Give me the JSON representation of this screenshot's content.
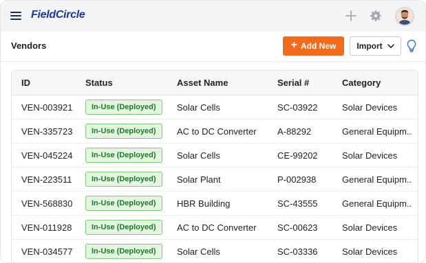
{
  "app": {
    "logo_text": "FieldCircle",
    "brand_color": "#1a3a8f"
  },
  "icons": {
    "menu": "hamburger-menu-icon",
    "add": "plus-icon",
    "settings": "gear-icon",
    "user": "avatar",
    "tips": "lightbulb-icon",
    "dropdown": "chevron-down-icon"
  },
  "header": {
    "title": "Vendors",
    "add_label": "Add New",
    "add_color": "#f26a1b",
    "import_label": "Import"
  },
  "table": {
    "columns": [
      "ID",
      "Status",
      "Asset Name",
      "Serial #",
      "Category"
    ],
    "rows": [
      {
        "id": "VEN-003921",
        "status": "In-Use (Deployed)",
        "asset": "Solar Cells",
        "serial": "SC-03922",
        "category": "Solar Devices"
      },
      {
        "id": "VEN-335723",
        "status": "In-Use (Deployed)",
        "asset": "AC to DC Converter",
        "serial": "A-88292",
        "category": "General Equipm.."
      },
      {
        "id": "VEN-045224",
        "status": "In-Use (Deployed)",
        "asset": "Solar Cells",
        "serial": "CE-99202",
        "category": "Solar Devices"
      },
      {
        "id": "VEN-223511",
        "status": "In-Use (Deployed)",
        "asset": "Solar Plant",
        "serial": "P-002938",
        "category": "General Equipm.."
      },
      {
        "id": "VEN-568830",
        "status": "In-Use (Deployed)",
        "asset": "HBR Building",
        "serial": "SC-43555",
        "category": "General Equipm.."
      },
      {
        "id": "VEN-011928",
        "status": "In-Use (Deployed)",
        "asset": "AC to DC Converter",
        "serial": "SC-00623",
        "category": "Solar Devices"
      },
      {
        "id": "VEN-034577",
        "status": "In-Use (Deployed)",
        "asset": "Solar Cells",
        "serial": "SC-03336",
        "category": "Solar Devices"
      }
    ],
    "status_color": "#1d7a25"
  }
}
